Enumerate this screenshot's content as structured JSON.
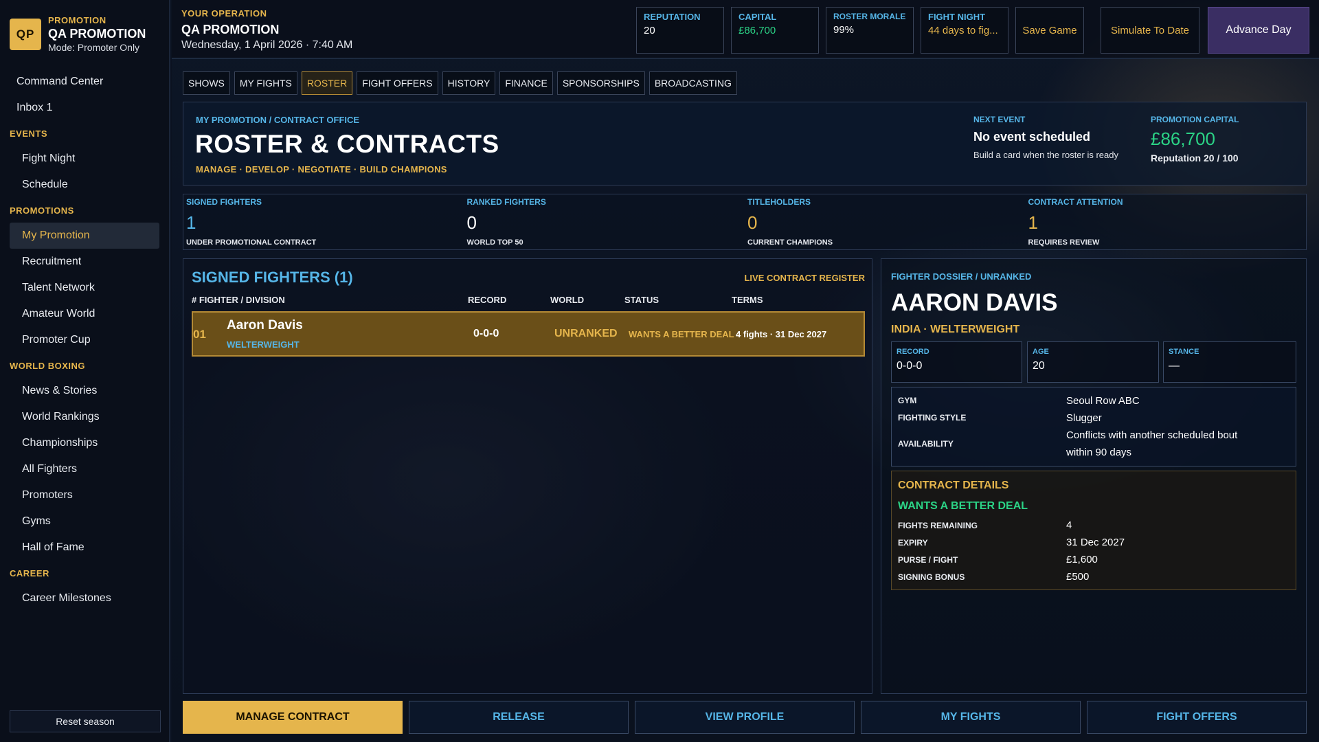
{
  "brand": {
    "badge": "QP",
    "kicker": "PROMOTION",
    "name": "QA PROMOTION",
    "mode": "Mode: Promoter Only"
  },
  "sidebar": {
    "items": [
      {
        "label": "Command Center",
        "type": "item"
      },
      {
        "label": "Inbox 1",
        "type": "item"
      },
      {
        "label": "EVENTS",
        "type": "section"
      },
      {
        "label": "Fight Night",
        "type": "sub"
      },
      {
        "label": "Schedule",
        "type": "sub"
      },
      {
        "label": "PROMOTIONS",
        "type": "section"
      },
      {
        "label": "My Promotion",
        "type": "sub",
        "active": true
      },
      {
        "label": "Recruitment",
        "type": "sub"
      },
      {
        "label": "Talent Network",
        "type": "sub"
      },
      {
        "label": "Amateur World",
        "type": "sub"
      },
      {
        "label": "Promoter Cup",
        "type": "sub"
      },
      {
        "label": "WORLD BOXING",
        "type": "section"
      },
      {
        "label": "News & Stories",
        "type": "sub"
      },
      {
        "label": "World Rankings",
        "type": "sub"
      },
      {
        "label": "Championships",
        "type": "sub"
      },
      {
        "label": "All Fighters",
        "type": "sub"
      },
      {
        "label": "Promoters",
        "type": "sub"
      },
      {
        "label": "Gyms",
        "type": "sub"
      },
      {
        "label": "Hall of Fame",
        "type": "sub"
      },
      {
        "label": "CAREER",
        "type": "section"
      },
      {
        "label": "Career Milestones",
        "type": "sub"
      }
    ],
    "reset_label": "Reset season"
  },
  "topbar": {
    "kicker": "YOUR OPERATION",
    "name": "QA PROMOTION",
    "date": "Wednesday, 1 April 2026 · 7:40 AM",
    "stats": [
      {
        "label": "REPUTATION",
        "value": "20",
        "color": "#ffffff"
      },
      {
        "label": "CAPITAL",
        "value": "£86,700",
        "color": "#2bd386"
      },
      {
        "label": "ROSTER MORALE",
        "value": "99%",
        "color": "#ffffff"
      },
      {
        "label": "FIGHT NIGHT",
        "value": "44 days to fig...",
        "color": "#e5b54c"
      }
    ],
    "save_label": "Save Game",
    "simulate_label": "Simulate To Date",
    "advance_label": "Advance Day"
  },
  "tabs": [
    "SHOWS",
    "MY FIGHTS",
    "ROSTER",
    "FIGHT OFFERS",
    "HISTORY",
    "FINANCE",
    "SPONSORSHIPS",
    "BROADCASTING"
  ],
  "active_tab": "ROSTER",
  "header": {
    "crumbs": "MY PROMOTION  /  CONTRACT OFFICE",
    "title": "ROSTER & CONTRACTS",
    "tags": "MANAGE  ·  DEVELOP  ·  NEGOTIATE  ·  BUILD CHAMPIONS",
    "next_label": "NEXT EVENT",
    "next_title": "No event scheduled",
    "next_sub": "Build a card when the roster is ready",
    "cap_label": "PROMOTION CAPITAL",
    "cap_value": "£86,700",
    "cap_sub": "Reputation 20 / 100"
  },
  "kpis": [
    {
      "label": "SIGNED FIGHTERS",
      "value": "1",
      "sub": "UNDER PROMOTIONAL CONTRACT",
      "color": "#56b6e8"
    },
    {
      "label": "RANKED FIGHTERS",
      "value": "0",
      "sub": "WORLD TOP 50",
      "color": "#ffffff"
    },
    {
      "label": "TITLEHOLDERS",
      "value": "0",
      "sub": "CURRENT CHAMPIONS",
      "color": "#e5b54c"
    },
    {
      "label": "CONTRACT ATTENTION",
      "value": "1",
      "sub": "REQUIRES REVIEW",
      "color": "#e5b54c"
    }
  ],
  "roster": {
    "title": "SIGNED FIGHTERS  (1)",
    "live": "LIVE CONTRACT REGISTER",
    "columns": {
      "num": "#  FIGHTER / DIVISION",
      "record": "RECORD",
      "world": "WORLD",
      "status": "STATUS",
      "terms": "TERMS"
    },
    "rows": [
      {
        "num": "01",
        "name": "Aaron Davis",
        "division": "WELTERWEIGHT",
        "record": "0-0-0",
        "world": "UNRANKED",
        "status": "WANTS A BETTER DEAL",
        "terms": "4 fights · 31 Dec 2027"
      }
    ]
  },
  "dossier": {
    "crumb": "FIGHTER DOSSIER  /  UNRANKED",
    "name": "AARON DAVIS",
    "meta": "INDIA  ·  WELTERWEIGHT",
    "boxes": [
      {
        "label": "RECORD",
        "value": "0-0-0"
      },
      {
        "label": "AGE",
        "value": "20"
      },
      {
        "label": "STANCE",
        "value": "—"
      }
    ],
    "gym_label": "GYM",
    "gym": "Seoul Row ABC",
    "style_label": "FIGHTING STYLE",
    "style": "Slugger",
    "avail_label": "AVAILABILITY",
    "avail_1": "Conflicts with another scheduled bout",
    "avail_2": "within 90 days",
    "contract_title": "CONTRACT DETAILS",
    "contract_status": "WANTS A BETTER DEAL",
    "contract": [
      {
        "label": "FIGHTS REMAINING",
        "value": "4"
      },
      {
        "label": "EXPIRY",
        "value": "31 Dec 2027"
      },
      {
        "label": "PURSE / FIGHT",
        "value": "£1,600"
      },
      {
        "label": "SIGNING BONUS",
        "value": "£500"
      }
    ]
  },
  "actions": [
    "MANAGE CONTRACT",
    "RELEASE",
    "VIEW PROFILE",
    "MY FIGHTS",
    "FIGHT OFFERS"
  ]
}
